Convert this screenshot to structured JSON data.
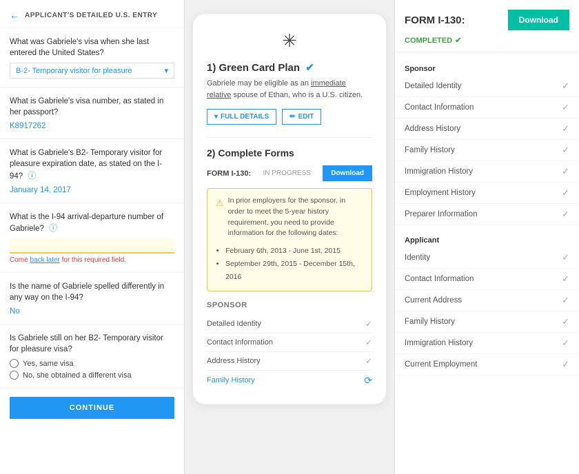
{
  "left": {
    "header": {
      "back_arrow": "←",
      "title": "APPLICANT'S DETAILED U.S. ENTRY"
    },
    "questions": [
      {
        "id": "q1",
        "label": "What was Gabriele's visa when she last entered the United States?",
        "answer_type": "dropdown",
        "answer": "B-2- Temporary visitor for pleasure"
      },
      {
        "id": "q2",
        "label": "What is Gabriele's visa number, as stated in her passport?",
        "answer_type": "text",
        "answer": "K8917262"
      },
      {
        "id": "q3",
        "label": "What is Gabriele's B2- Temporary visitor for pleasure expiration date, as stated on the I-94?",
        "info_icon": true,
        "answer_type": "date",
        "answer": "January 14, 2017"
      },
      {
        "id": "q4",
        "label": "What is the I-94 arrival-departure number of Gabriele?",
        "info_icon": true,
        "answer_type": "input_empty",
        "error_text": "Come back later for this required field."
      },
      {
        "id": "q5",
        "label": "Is the name of Gabriele spelled differently in any way on the I-94?",
        "answer_type": "text",
        "answer": "No"
      },
      {
        "id": "q6",
        "label": "Is Gabriele still on her B2- Temporary visitor for pleasure visa?",
        "answer_type": "radio",
        "options": [
          "Yes, same visa",
          "No, she obtained a different visa"
        ]
      }
    ],
    "continue_button": "CONTINUE"
  },
  "middle": {
    "compass_icon": "✳",
    "section1": {
      "title": "1) Green Card Plan",
      "checkmark": "✔",
      "description_prefix": "Gabriele may be eligible as an ",
      "description_link": "immediate relative",
      "description_suffix": " spouse of Ethan, who is a U.S. citizen.",
      "btn_full_details": "FULL DETAILS",
      "btn_edit": "EDIT"
    },
    "section2": {
      "title": "2) Complete Forms",
      "form_label": "FORM I-130:",
      "form_status": "IN PROGRESS",
      "btn_download": "Download",
      "warning": {
        "text": "In prior employers for the sponsor, in order to meet the 5-year history requirement, you need to provide information for the following dates:",
        "dates": [
          "February 6th, 2013 - June 1st, 2015",
          "September 29th, 2015 - December 15th, 2016"
        ]
      },
      "sponsor_title": "Sponsor",
      "checklist": [
        {
          "label": "Detailed Identity",
          "status": "check"
        },
        {
          "label": "Contact Information",
          "status": "check"
        },
        {
          "label": "Address History",
          "status": "check"
        },
        {
          "label": "Family History",
          "status": "link"
        }
      ]
    }
  },
  "right": {
    "form_title": "FORM I-130:",
    "btn_download": "Download",
    "completed_label": "COMPLETED",
    "completed_checkmark": "✔",
    "sponsor_group": {
      "title": "Sponsor",
      "items": [
        {
          "label": "Detailed Identity",
          "checked": true
        },
        {
          "label": "Contact Information",
          "checked": true
        },
        {
          "label": "Address History",
          "checked": true
        },
        {
          "label": "Family History",
          "checked": true
        },
        {
          "label": "Immigration History",
          "checked": true
        },
        {
          "label": "Employment History",
          "checked": true
        },
        {
          "label": "Preparer Information",
          "checked": true
        }
      ]
    },
    "applicant_group": {
      "title": "Applicant",
      "items": [
        {
          "label": "Identity",
          "checked": true
        },
        {
          "label": "Contact Information",
          "checked": true
        },
        {
          "label": "Current Address",
          "checked": true
        },
        {
          "label": "Family History",
          "checked": true
        },
        {
          "label": "Immigration History",
          "checked": true
        },
        {
          "label": "Current Employment",
          "checked": true
        }
      ]
    }
  }
}
